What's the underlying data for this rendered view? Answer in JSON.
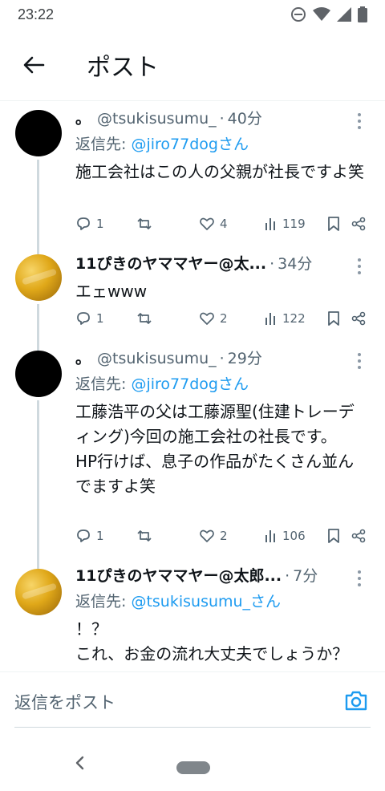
{
  "status_bar": {
    "time": "23:22"
  },
  "header": {
    "title": "ポスト"
  },
  "posts": [
    {
      "display_name": "。",
      "handle": "@tsukisusumu_",
      "dot": "·",
      "time": "40分",
      "reply_prefix": "返信先: ",
      "reply_to": "@jiro77dogさん",
      "text": "施工会社はこの人の父親が社長ですよ笑",
      "replies": "1",
      "reposts": "",
      "likes": "4",
      "views": "119"
    },
    {
      "display_name": "11ぴきのヤママヤー@太...",
      "handle": "",
      "dot": "·",
      "time": "34分",
      "reply_prefix": "",
      "reply_to": "",
      "text": "エェwww",
      "replies": "1",
      "reposts": "",
      "likes": "2",
      "views": "122"
    },
    {
      "display_name": "。",
      "handle": "@tsukisusumu_",
      "dot": "·",
      "time": "29分",
      "reply_prefix": "返信先: ",
      "reply_to": "@jiro77dogさん",
      "text": "工藤浩平の父は工藤源聖(住建トレーディング)今回の施工会社の社長です。\nHP行けば、息子の作品がたくさん並んでますよ笑",
      "replies": "1",
      "reposts": "",
      "likes": "2",
      "views": "106"
    },
    {
      "display_name": "11ぴきのヤママヤー@太郎...",
      "handle": "",
      "dot": "·",
      "time": "7分",
      "reply_prefix": "返信先: ",
      "reply_to": "@tsukisusumu_さん",
      "text": "！？\nこれ、お金の流れ大丈夫でしょうか？"
    }
  ],
  "composer": {
    "placeholder": "返信をポスト"
  },
  "colors": {
    "accent": "#1d9bf0",
    "secondary_text": "#536471",
    "thread_line": "#cfd9de"
  },
  "icons": [
    "back-arrow-icon",
    "dnd-icon",
    "wifi-icon",
    "signal-icon",
    "battery-icon",
    "reply-icon",
    "repost-icon",
    "like-icon",
    "views-icon",
    "bookmark-icon",
    "share-icon",
    "more-icon",
    "camera-icon",
    "nav-back-icon"
  ]
}
